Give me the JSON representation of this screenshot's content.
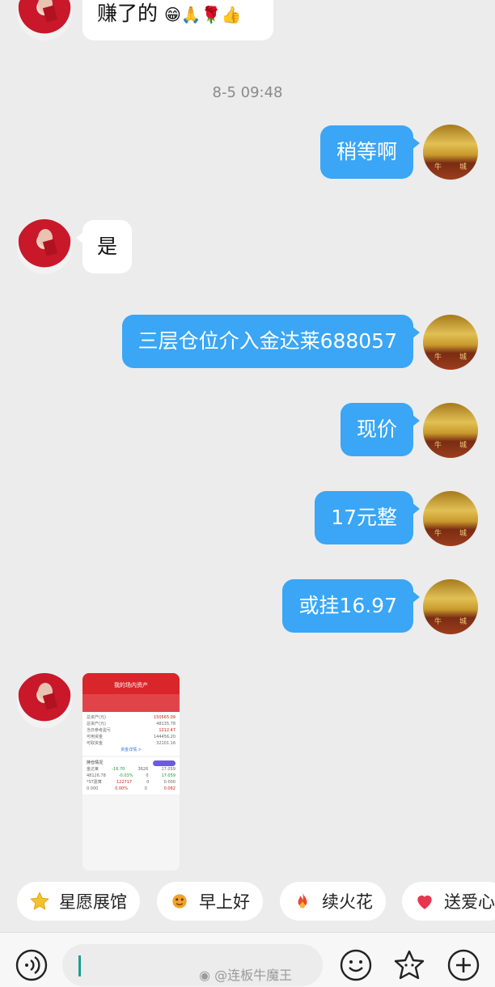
{
  "chat": {
    "top_partial_message": "赚了的",
    "timestamp": "8-5 09:48",
    "messages": [
      {
        "side": "right",
        "text": "稍等啊"
      },
      {
        "side": "left",
        "text": "是"
      },
      {
        "side": "right",
        "text": "三层仓位介入金达莱688057"
      },
      {
        "side": "right",
        "text": "现价"
      },
      {
        "side": "right",
        "text": "17元整"
      },
      {
        "side": "right",
        "text": "或挂16.97"
      }
    ],
    "image_message": {
      "header": "我的场内资产",
      "total_value": "150565.09",
      "rows": [
        {
          "label": "总资产(元)",
          "value": "48135.78"
        },
        {
          "label": "当日参考盈亏",
          "value": "1212.47"
        },
        {
          "label": "可用资金",
          "value": "144456.20"
        },
        {
          "label": "可取资金",
          "value": "32101.16"
        }
      ],
      "funds_detail": "资金详情 >",
      "positions_title": "持仓情况",
      "positions_tag": "去看看",
      "position_rows": [
        {
          "name": "金达莱",
          "a": "-16.70",
          "b": "3626",
          "c": "17.059"
        },
        {
          "name": "48126.78",
          "a": "-0.03%",
          "b": "0",
          "c": "17.059"
        },
        {
          "name": "*ST嘉寓",
          "a": "122717",
          "b": "0",
          "c": "0.000"
        },
        {
          "name": "0.000",
          "a": "0.00%",
          "b": "0",
          "c": "0.062"
        }
      ]
    }
  },
  "quick_chips": [
    {
      "icon": "star-icon",
      "label": "星愿展馆",
      "color": "#f5c12a"
    },
    {
      "icon": "sun-face-icon",
      "label": "早上好",
      "color": "#f3a12a"
    },
    {
      "icon": "fire-icon",
      "label": "续火花",
      "color": "#f0452b"
    },
    {
      "icon": "heart-icon",
      "label": "送爱心",
      "color": "#e8364f"
    }
  ],
  "input_bar": {
    "voice_icon": "voice-icon",
    "emoji_icon": "emoji-icon",
    "sticker_icon": "sticker-icon",
    "plus_icon": "plus-icon",
    "text_value": ""
  },
  "watermark": "@连板牛魔王",
  "colors": {
    "bubble_right": "#3aa6f5",
    "background": "#ececec"
  }
}
